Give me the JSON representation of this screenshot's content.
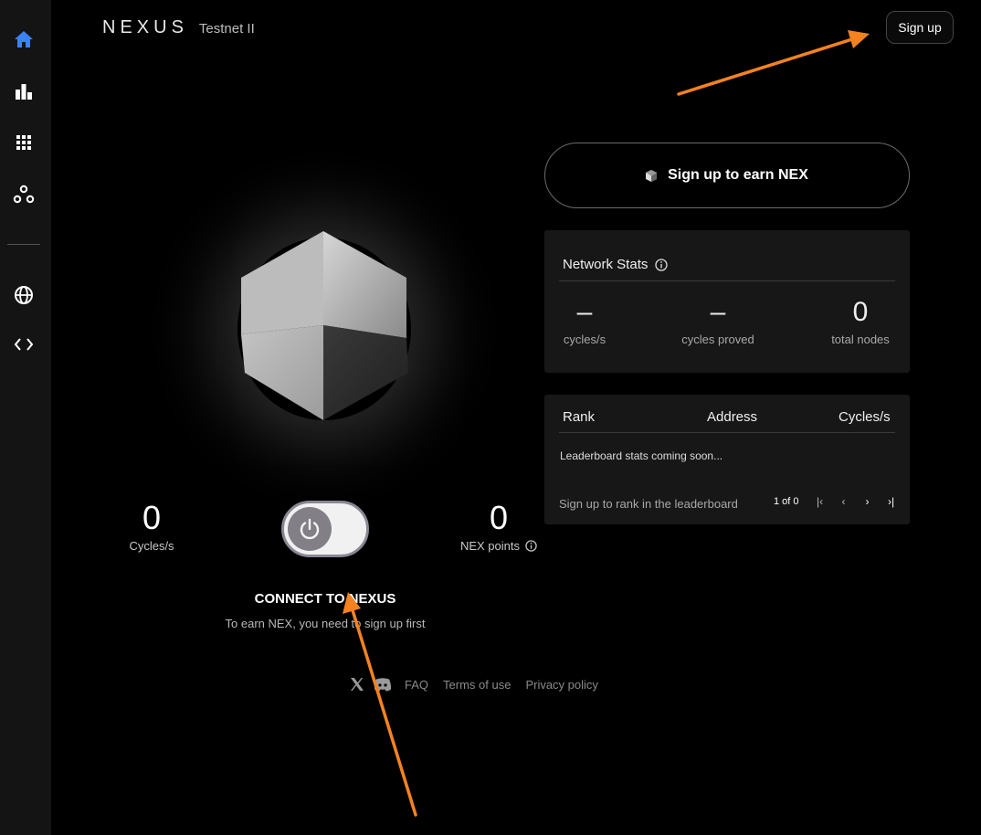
{
  "sidebar": {
    "items": [
      {
        "icon": "home-icon",
        "active": true
      },
      {
        "icon": "bar-chart-icon"
      },
      {
        "icon": "apps-grid-icon"
      },
      {
        "icon": "nodes-icon"
      },
      {
        "icon": "globe-icon"
      },
      {
        "icon": "code-icon"
      }
    ]
  },
  "header": {
    "logo": "NEXUS",
    "network": "Testnet II",
    "signup_label": "Sign up"
  },
  "earn": {
    "label": "Sign up to earn NEX",
    "icon": "cube-icon"
  },
  "stats": {
    "title": "Network Stats",
    "items": [
      {
        "value": "–",
        "label": "cycles/s"
      },
      {
        "value": "–",
        "label": "cycles proved"
      },
      {
        "value": "0",
        "label": "total nodes"
      }
    ]
  },
  "leaderboard": {
    "columns": [
      "Rank",
      "Address",
      "Cycles/s"
    ],
    "message": "Leaderboard stats coming soon...",
    "footer_text": "Sign up to rank in the leaderboard",
    "pagination": "1 of 0"
  },
  "prover": {
    "cycles_value": "0",
    "cycles_label": "Cycles/s",
    "points_value": "0",
    "points_label": "NEX points",
    "connect_title": "CONNECT TO NEXUS",
    "connect_subtitle": "To earn NEX, you need to sign up first"
  },
  "footer": {
    "links": [
      "FAQ",
      "Terms of use",
      "Privacy policy"
    ]
  },
  "colors": {
    "accent": "#3b82f6",
    "annotation_arrow": "#f58220",
    "background": "#000000",
    "card": "#171717"
  }
}
